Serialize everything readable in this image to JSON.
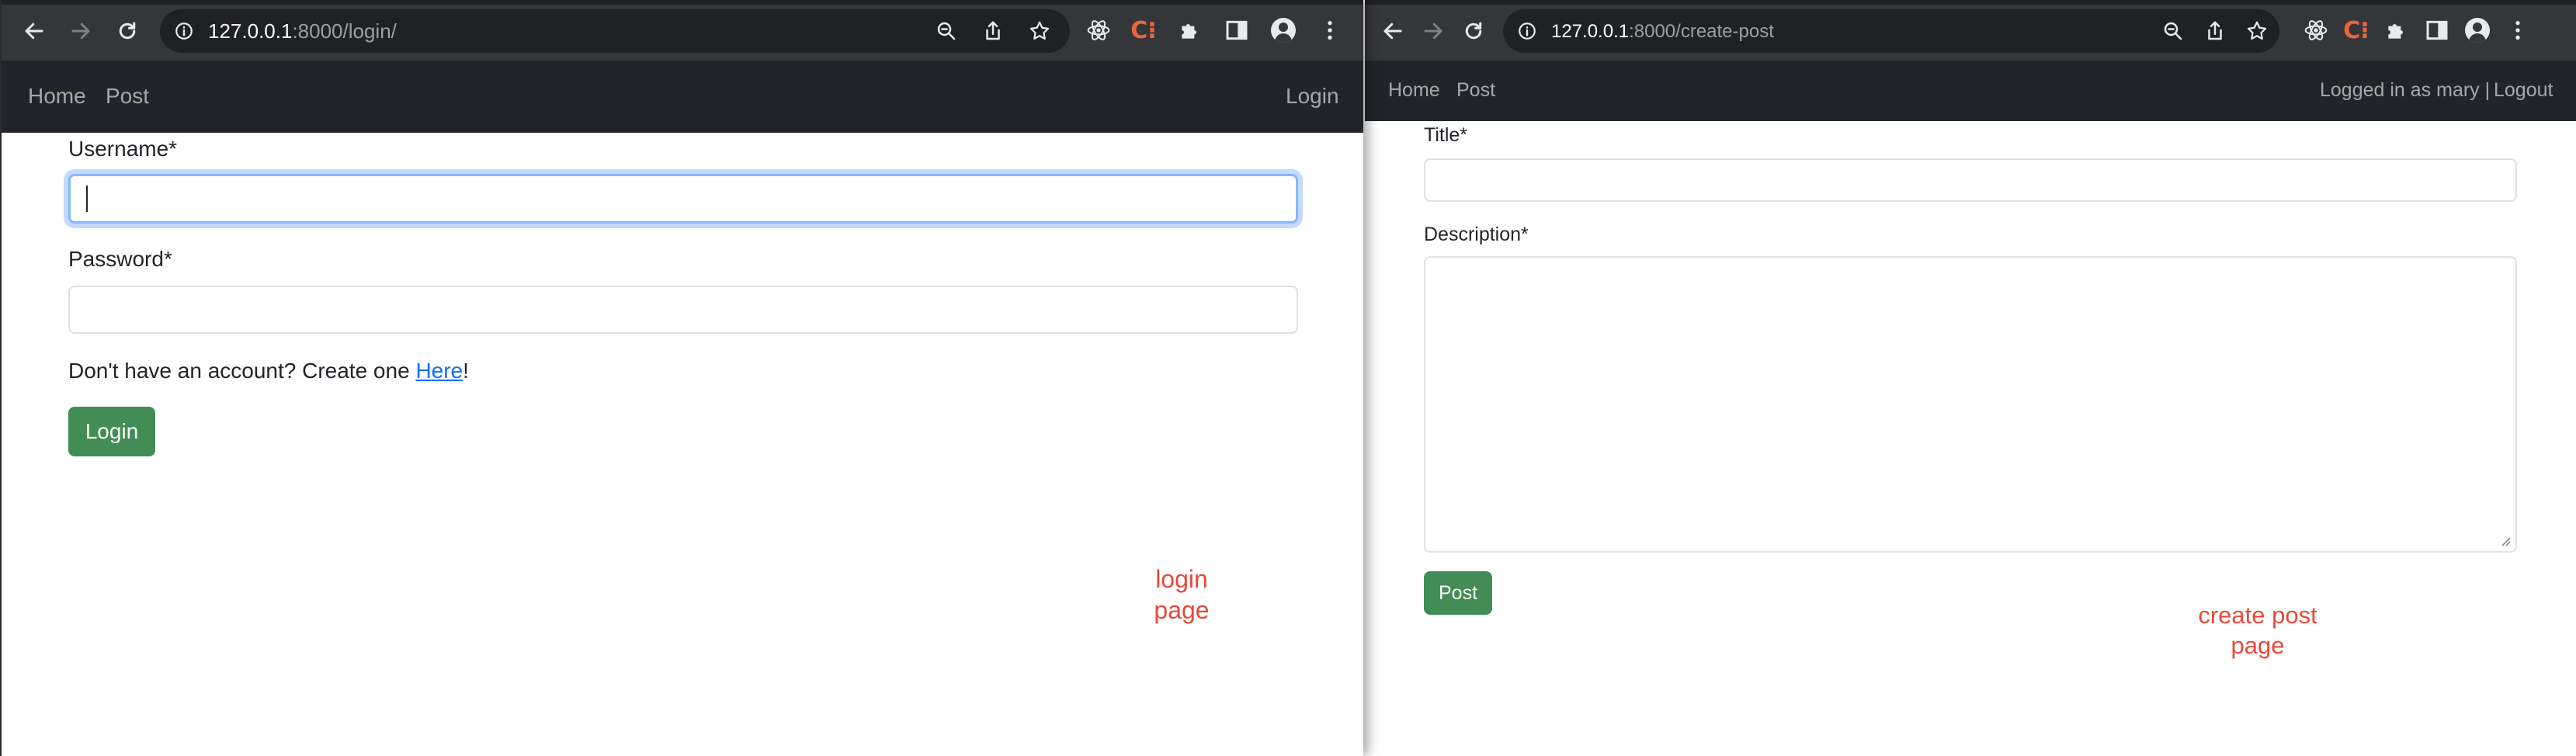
{
  "login_window": {
    "address_bar": {
      "host": "127.0.0.1",
      "rest": ":8000/login/"
    },
    "navbar": {
      "links": [
        "Home",
        "Post"
      ],
      "right_link": "Login"
    },
    "form": {
      "username_label": "Username*",
      "password_label": "Password*",
      "signup_prompt": "Don't have an account? Create one ",
      "signup_link": "Here",
      "signup_suffix": "!",
      "submit_label": "Login"
    },
    "annotation": {
      "line1": "login",
      "line2": "page"
    }
  },
  "create_post_window": {
    "address_bar": {
      "host": "127.0.0.1",
      "rest": ":8000/create-post"
    },
    "navbar": {
      "links": [
        "Home",
        "Post"
      ],
      "status": "Logged in as mary |",
      "logout": "Logout"
    },
    "form": {
      "title_label": "Title*",
      "description_label": "Description*",
      "submit_label": "Post"
    },
    "annotation": {
      "line1": "create post",
      "line2": "page"
    }
  },
  "icons": {
    "back": "arrow-left-icon",
    "forward": "arrow-right-icon",
    "reload": "reload-icon",
    "info": "info-icon",
    "zoom": "zoom-icon",
    "share": "share-icon",
    "star": "star-icon",
    "react_devtools": "react-icon",
    "extension_c": "c-extension-icon",
    "extensions": "puzzle-icon",
    "side_panel": "side-panel-icon",
    "profile": "profile-icon",
    "menu": "kebab-menu-icon"
  },
  "colors": {
    "chrome_toolbar": "#35363a",
    "omnibox": "#202124",
    "navbar": "#212529",
    "success_button": "#418d55",
    "link": "#0d6efd",
    "annotation": "#e8493a",
    "focus_ring": "#86b7fe"
  }
}
